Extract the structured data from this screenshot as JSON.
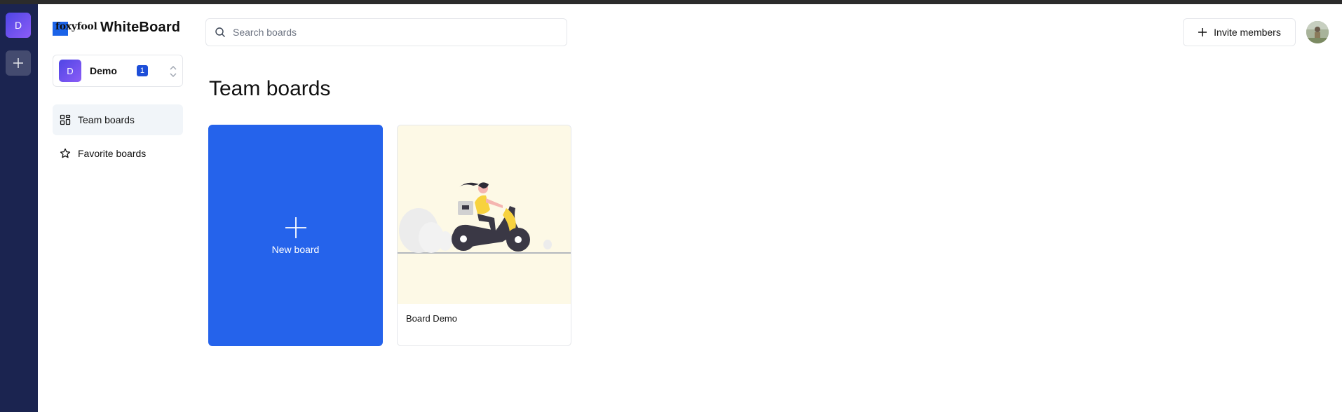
{
  "app": {
    "logo_text": "foxyfool",
    "title": "WhiteBoard"
  },
  "rail": {
    "org_initial": "D"
  },
  "org_switcher": {
    "initial": "D",
    "name": "Demo",
    "count": "1"
  },
  "nav": {
    "items": [
      {
        "label": "Team boards",
        "icon": "grid-icon",
        "active": true
      },
      {
        "label": "Favorite boards",
        "icon": "star-icon",
        "active": false
      }
    ]
  },
  "search": {
    "placeholder": "Search boards"
  },
  "header": {
    "invite_label": "Invite members"
  },
  "main": {
    "title": "Team boards",
    "new_board_label": "New board",
    "boards": [
      {
        "name": "Board Demo"
      }
    ]
  },
  "colors": {
    "rail_bg": "#1b2450",
    "accent": "#2563eb",
    "badge": "#1d4ed8",
    "thumb_bg": "#fdf9e6"
  }
}
